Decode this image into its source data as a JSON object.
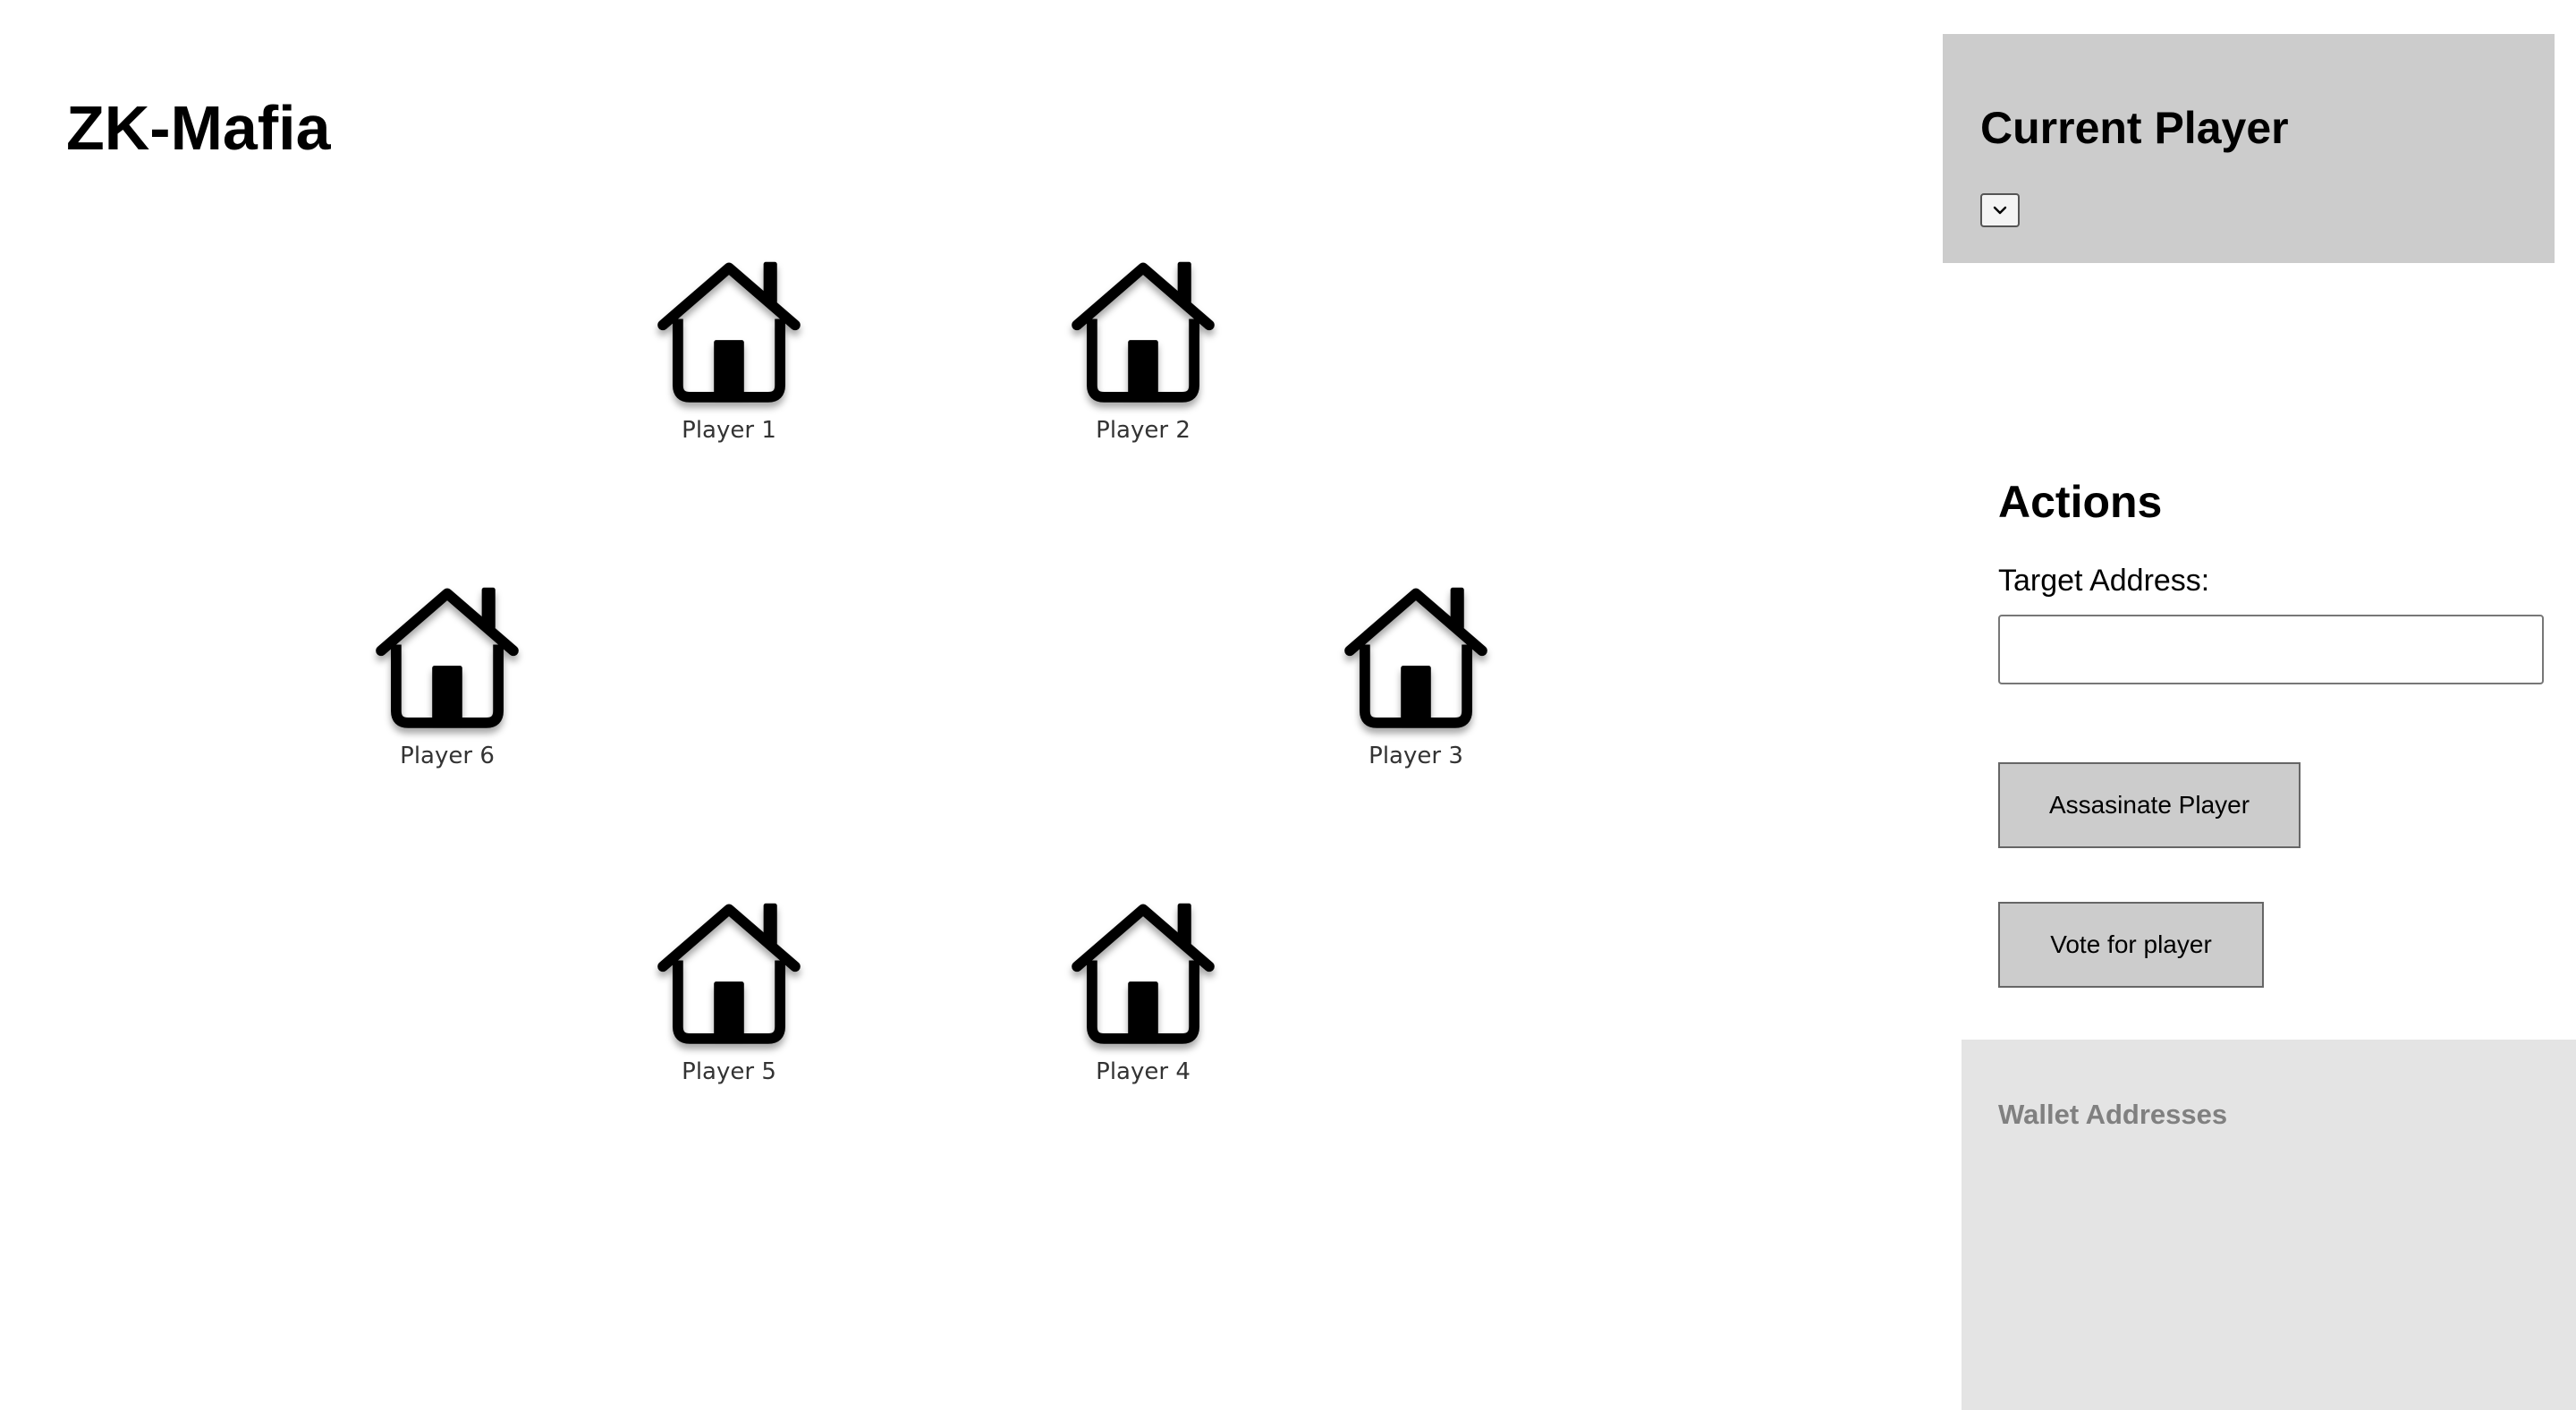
{
  "app": {
    "title": "ZK-Mafia"
  },
  "board": {
    "houses": [
      {
        "label": "Player 1",
        "icon": "house-icon"
      },
      {
        "label": "Player 2",
        "icon": "house-icon"
      },
      {
        "label": "Player 3",
        "icon": "house-icon"
      },
      {
        "label": "Player 4",
        "icon": "house-icon"
      },
      {
        "label": "Player 5",
        "icon": "house-icon"
      },
      {
        "label": "Player 6",
        "icon": "house-icon"
      }
    ]
  },
  "current_player": {
    "heading": "Current Player",
    "select_value": "",
    "select_icon": "chevron-down-icon"
  },
  "actions": {
    "heading": "Actions",
    "target_label": "Target Address:",
    "target_value": "",
    "assassinate_label": "Assasinate Player",
    "vote_label": "Vote for player"
  },
  "wallet": {
    "heading": "Wallet Addresses"
  },
  "colors": {
    "panel_bg": "#cccccc",
    "wallet_bg": "#e4e4e4",
    "wallet_heading": "#808080",
    "button_bg": "#cccccc"
  }
}
